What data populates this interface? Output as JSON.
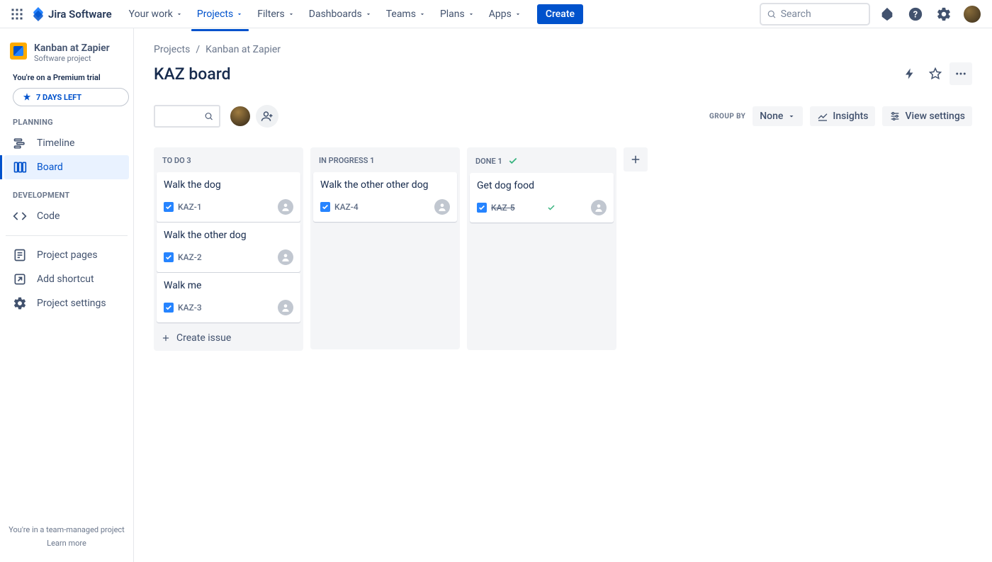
{
  "topnav": {
    "logo_text": "Jira Software",
    "items": [
      {
        "label": "Your work"
      },
      {
        "label": "Projects",
        "active": true
      },
      {
        "label": "Filters"
      },
      {
        "label": "Dashboards"
      },
      {
        "label": "Teams"
      },
      {
        "label": "Plans"
      },
      {
        "label": "Apps"
      }
    ],
    "create_label": "Create",
    "search_placeholder": "Search"
  },
  "sidebar": {
    "project_name": "Kanban at Zapier",
    "project_type": "Software project",
    "trial_note": "You're on a Premium trial",
    "trial_days": "7 DAYS LEFT",
    "sections": {
      "planning_label": "PLANNING",
      "development_label": "DEVELOPMENT"
    },
    "items": {
      "timeline": "Timeline",
      "board": "Board",
      "code": "Code",
      "project_pages": "Project pages",
      "add_shortcut": "Add shortcut",
      "project_settings": "Project settings"
    },
    "footer_line1": "You're in a team-managed project",
    "footer_line2": "Learn more"
  },
  "breadcrumb": {
    "projects": "Projects",
    "project": "Kanban at Zapier"
  },
  "board_title": "KAZ board",
  "toolbar": {
    "group_by_label": "GROUP BY",
    "group_by_value": "None",
    "insights_label": "Insights",
    "view_settings_label": "View settings"
  },
  "columns": [
    {
      "title": "TO DO",
      "count": "3",
      "show_done_check": false,
      "cards": [
        {
          "title": "Walk the dog",
          "key": "KAZ-1",
          "done": false
        },
        {
          "title": "Walk the other dog",
          "key": "KAZ-2",
          "done": false
        },
        {
          "title": "Walk me",
          "key": "KAZ-3",
          "done": false
        }
      ],
      "show_create": true
    },
    {
      "title": "IN PROGRESS",
      "count": "1",
      "show_done_check": false,
      "cards": [
        {
          "title": "Walk the other other dog",
          "key": "KAZ-4",
          "done": false
        }
      ],
      "show_create": false
    },
    {
      "title": "DONE",
      "count": "1",
      "show_done_check": true,
      "cards": [
        {
          "title": "Get dog food",
          "key": "KAZ-5",
          "done": true
        }
      ],
      "show_create": false
    }
  ],
  "create_issue_label": "Create issue"
}
